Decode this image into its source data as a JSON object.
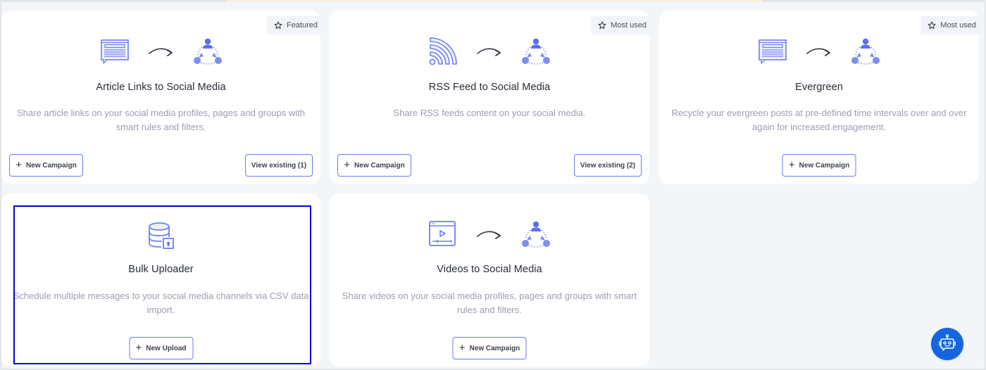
{
  "colors": {
    "accent": "#5b6ef5",
    "button_border": "#6a7bef",
    "title": "#262b36",
    "description": "#9a9fb0",
    "page_bg": "#f3f6f9",
    "chat_button": "#1565e0",
    "selection_outline": "#0000d8"
  },
  "cards": [
    {
      "badge": "Featured",
      "badge_icon": "star-outline-icon",
      "source_icon": "article-icon",
      "title": "Article Links to Social Media",
      "description": "Share article links on your social media profiles, pages and groups with smart rules and filters.",
      "primary_button": "New Campaign",
      "secondary_button": "View existing (1)"
    },
    {
      "badge": "Most used",
      "badge_icon": "star-outline-icon",
      "source_icon": "rss-icon",
      "title": "RSS Feed to Social Media",
      "description": "Share RSS feeds content on your social media.",
      "primary_button": "New Campaign",
      "secondary_button": "View existing (2)"
    },
    {
      "badge": "Most used",
      "badge_icon": "star-outline-icon",
      "source_icon": "article-icon",
      "title": "Evergreen",
      "description": "Recycle your evergreen posts at pre-defined time intervals over and over again for increased engagement.",
      "primary_button": "New Campaign"
    },
    {
      "source_icon": "database-upload-icon",
      "title": "Bulk Uploader",
      "description": "Schedule multiple messages to your social media channels via CSV data import.",
      "primary_button": "New Upload",
      "selected": true
    },
    {
      "source_icon": "video-player-icon",
      "title": "Videos to Social Media",
      "description": "Share videos on your social media profiles, pages and groups with smart rules and filters.",
      "primary_button": "New Campaign"
    }
  ],
  "chat_widget": {
    "icon": "chatbot-icon"
  }
}
